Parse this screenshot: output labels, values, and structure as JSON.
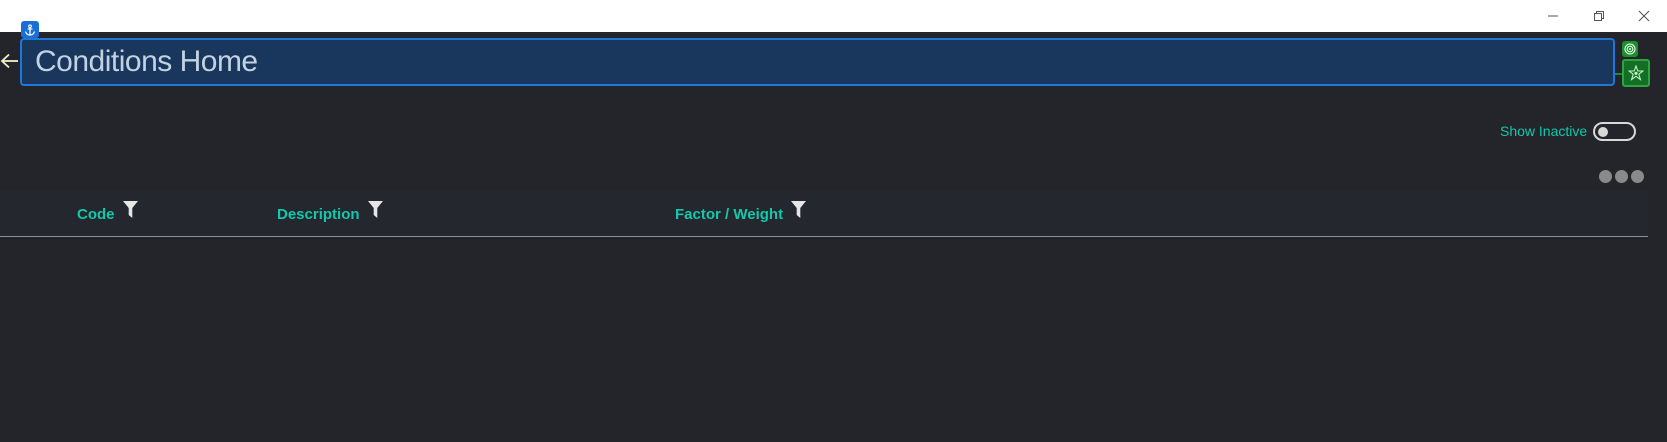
{
  "window": {
    "controls": {
      "minimize_icon": "minimize-icon",
      "restore_icon": "restore-icon",
      "close_icon": "close-icon"
    }
  },
  "header": {
    "title": "Conditions Home",
    "back_icon": "arrow-left-icon",
    "anchor_icon": "anchor-icon",
    "target_icon": "target-icon",
    "star_icon": "star-badge-icon"
  },
  "toolbar": {
    "show_inactive_label": "Show Inactive",
    "show_inactive_on": false,
    "more_icon": "more-dots-icon"
  },
  "grid": {
    "columns": [
      {
        "label": "Code",
        "filter_icon": "filter-icon"
      },
      {
        "label": "Description",
        "filter_icon": "filter-icon"
      },
      {
        "label": "Factor / Weight",
        "filter_icon": "filter-icon"
      }
    ],
    "rows": []
  },
  "colors": {
    "background": "#23252b",
    "accent_teal": "#13c8ab",
    "title_fill": "#19365c",
    "title_border": "#1f78d8",
    "badge_green": "#1b8f2e"
  }
}
